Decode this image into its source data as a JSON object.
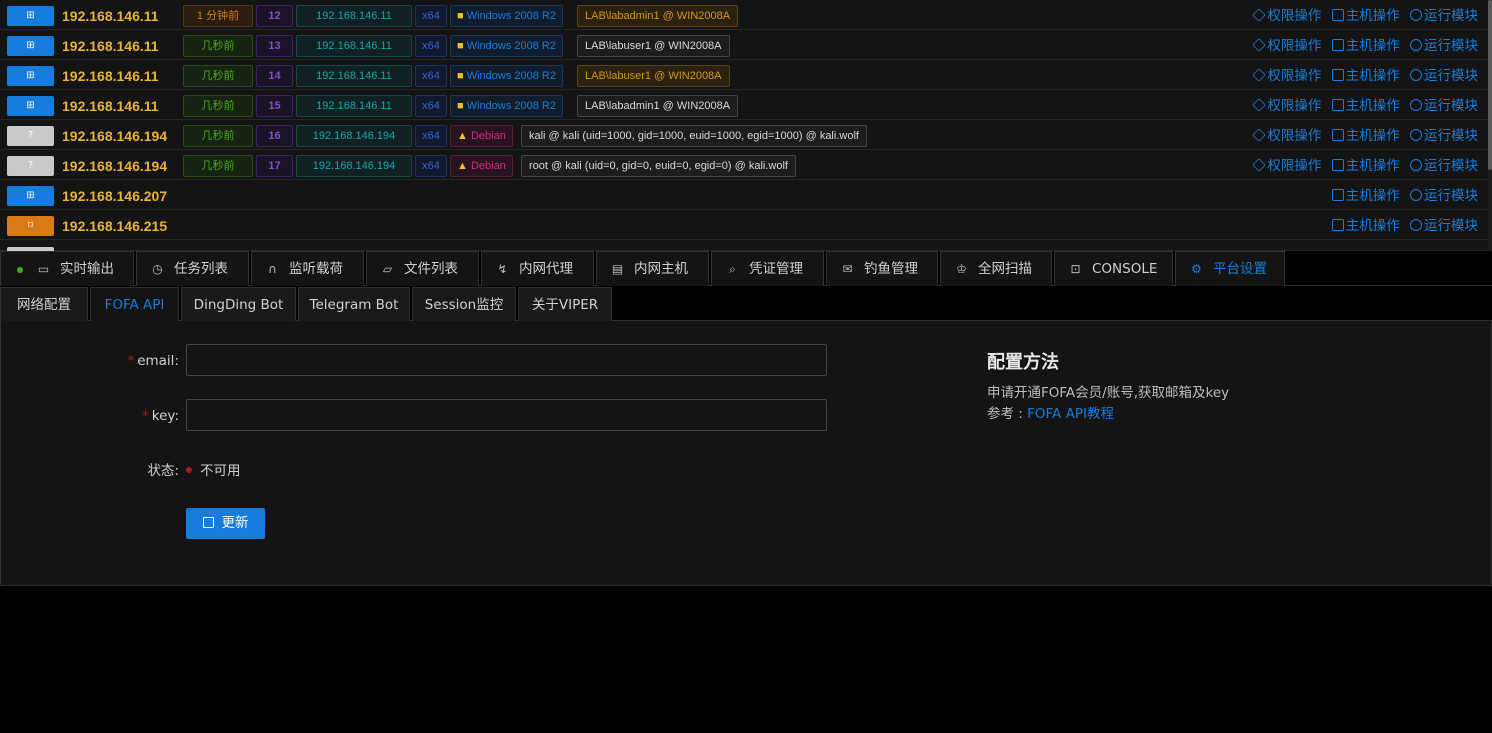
{
  "sessions": [
    {
      "platform_icon": "windows-icon",
      "platform_color": "#177ddc",
      "ip": "192.168.146.11",
      "time": "1 分钟前",
      "time_state": "warn",
      "id": "12",
      "local_ip": "192.168.146.11",
      "arch": "x64",
      "os": "Windows 2008 R2",
      "os_icon": "windows-logo-icon",
      "user": "LAB\\labadmin1 @ WIN2008A",
      "user_style": "gold",
      "actions": [
        "权限操作",
        "主机操作",
        "运行模块"
      ]
    },
    {
      "platform_icon": "windows-icon",
      "platform_color": "#177ddc",
      "ip": "192.168.146.11",
      "time": "几秒前",
      "time_state": "ok",
      "id": "13",
      "local_ip": "192.168.146.11",
      "arch": "x64",
      "os": "Windows 2008 R2",
      "os_icon": "windows-logo-icon",
      "user": "LAB\\labuser1 @ WIN2008A",
      "user_style": "grey",
      "actions": [
        "权限操作",
        "主机操作",
        "运行模块"
      ]
    },
    {
      "platform_icon": "windows-icon",
      "platform_color": "#177ddc",
      "ip": "192.168.146.11",
      "time": "几秒前",
      "time_state": "ok",
      "id": "14",
      "local_ip": "192.168.146.11",
      "arch": "x64",
      "os": "Windows 2008 R2",
      "os_icon": "windows-logo-icon",
      "user": "LAB\\labuser1 @ WIN2008A",
      "user_style": "gold",
      "actions": [
        "权限操作",
        "主机操作",
        "运行模块"
      ]
    },
    {
      "platform_icon": "windows-icon",
      "platform_color": "#177ddc",
      "ip": "192.168.146.11",
      "time": "几秒前",
      "time_state": "ok",
      "id": "15",
      "local_ip": "192.168.146.11",
      "arch": "x64",
      "os": "Windows 2008 R2",
      "os_icon": "windows-logo-icon",
      "user": "LAB\\labadmin1 @ WIN2008A",
      "user_style": "grey",
      "actions": [
        "权限操作",
        "主机操作",
        "运行模块"
      ]
    },
    {
      "platform_icon": "unknown-icon",
      "platform_color": "#c9c9c9",
      "platform_glyph": "?",
      "ip": "192.168.146.194",
      "time": "几秒前",
      "time_state": "ok",
      "id": "16",
      "local_ip": "192.168.146.194",
      "arch": "x64",
      "os": "Debian",
      "os_icon": "linux-tux-icon",
      "user": "kali @ kali (uid=1000, gid=1000, euid=1000, egid=1000) @ kali.wolf",
      "user_style": "grey",
      "actions": [
        "权限操作",
        "主机操作",
        "运行模块"
      ]
    },
    {
      "platform_icon": "unknown-icon",
      "platform_color": "#c9c9c9",
      "platform_glyph": "?",
      "ip": "192.168.146.194",
      "time": "几秒前",
      "time_state": "ok",
      "id": "17",
      "local_ip": "192.168.146.194",
      "arch": "x64",
      "os": "Debian",
      "os_icon": "linux-tux-icon",
      "user": "root @ kali (uid=0, gid=0, euid=0, egid=0) @ kali.wolf",
      "user_style": "grey",
      "actions": [
        "权限操作",
        "主机操作",
        "运行模块"
      ]
    }
  ],
  "hosts": [
    {
      "platform_icon": "windows-icon",
      "platform_color": "#177ddc",
      "ip": "192.168.146.207",
      "actions": [
        "主机操作",
        "运行模块"
      ]
    },
    {
      "platform_icon": "router-icon",
      "platform_color": "#d87a16",
      "ip": "192.168.146.215",
      "actions": [
        "主机操作",
        "运行模块"
      ]
    }
  ],
  "main_tabs": [
    {
      "label": "实时输出",
      "icon": "monitor-icon"
    },
    {
      "label": "任务列表",
      "icon": "clock-icon"
    },
    {
      "label": "监听载荷",
      "icon": "headphones-icon"
    },
    {
      "label": "文件列表",
      "icon": "folder-icon"
    },
    {
      "label": "内网代理",
      "icon": "proxy-icon"
    },
    {
      "label": "内网主机",
      "icon": "server-icon"
    },
    {
      "label": "凭证管理",
      "icon": "search-icon"
    },
    {
      "label": "钓鱼管理",
      "icon": "mail-icon"
    },
    {
      "label": "全网扫描",
      "icon": "crown-icon"
    },
    {
      "label": "CONSOLE",
      "icon": "terminal-icon"
    },
    {
      "label": "平台设置",
      "icon": "gear-icon",
      "active": true
    }
  ],
  "sub_tabs": [
    {
      "label": "网络配置"
    },
    {
      "label": "FOFA API",
      "active": true
    },
    {
      "label": "DingDing Bot"
    },
    {
      "label": "Telegram Bot"
    },
    {
      "label": "Session监控"
    },
    {
      "label": "关于VIPER"
    }
  ],
  "form": {
    "email_label": "email",
    "email_value": "",
    "key_label": "key",
    "key_value": "",
    "status_label": "状态",
    "status_value": "不可用",
    "status_color": "#a61d24",
    "submit_label": "更新"
  },
  "howto": {
    "title": "配置方法",
    "line1": "申请开通FOFA会员/账号,获取邮箱及key",
    "ref_label": "参考 : ",
    "ref_link": "FOFA API教程"
  },
  "colors": {
    "accent": "#177ddc",
    "ip": "#e8b339",
    "success": "#49aa19"
  }
}
